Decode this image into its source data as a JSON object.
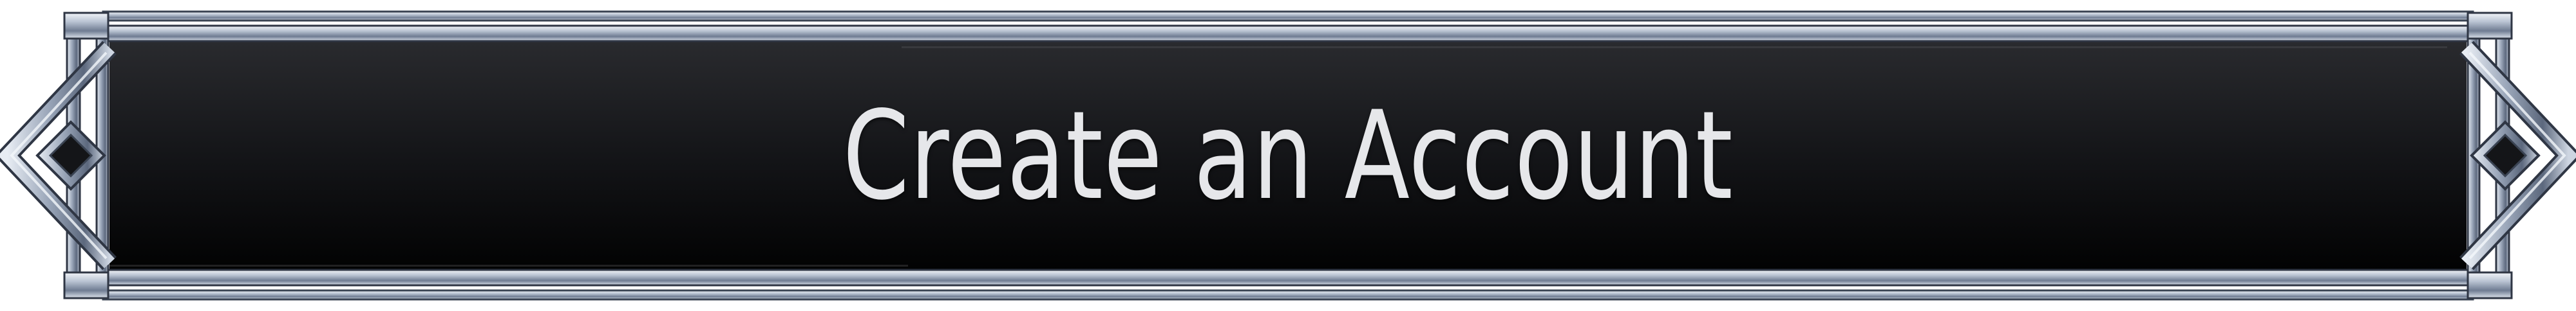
{
  "button": {
    "label": "Create an Account"
  },
  "colors": {
    "panel_top": "#2c2d31",
    "panel_bottom": "#000000",
    "frame_light": "#e4e9f0",
    "frame_mid": "#8e9bb0",
    "frame_dark": "#3a4352",
    "label": "#e6e7ea"
  },
  "icons": {
    "left_ornament": "diamond-ornament-icon",
    "right_ornament": "diamond-ornament-icon"
  }
}
